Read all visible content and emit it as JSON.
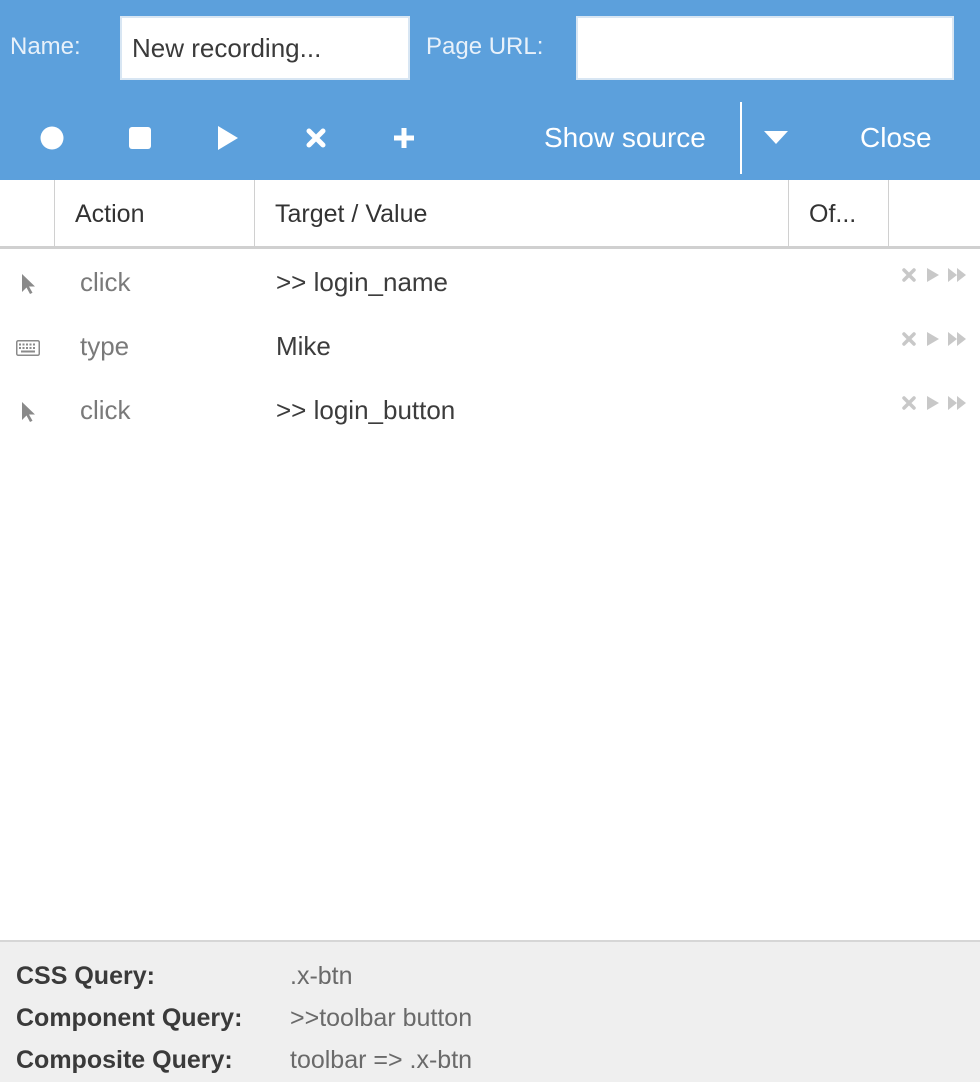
{
  "header": {
    "name_label": "Name:",
    "name_value": "New recording...",
    "url_label": "Page URL:",
    "url_value": "",
    "show_source_label": "Show source",
    "close_label": "Close",
    "icon_color": "#ffffff",
    "background": "#5ca0dc"
  },
  "toolbar": {
    "buttons": [
      {
        "name": "record",
        "icon": "record-circle-icon"
      },
      {
        "name": "stop",
        "icon": "stop-square-icon"
      },
      {
        "name": "play",
        "icon": "play-triangle-icon"
      },
      {
        "name": "clear",
        "icon": "close-x-icon"
      },
      {
        "name": "add",
        "icon": "plus-icon"
      }
    ],
    "dropdown_icon": "caret-down-icon"
  },
  "grid": {
    "columns": [
      "Action",
      "Target / Value",
      "Of..."
    ],
    "rows": [
      {
        "icon": "pointer-icon",
        "action": "click",
        "target": ">> login_name"
      },
      {
        "icon": "keyboard-icon",
        "action": "type",
        "target": "Mike"
      },
      {
        "icon": "pointer-icon",
        "action": "click",
        "target": ">> login_button"
      }
    ],
    "row_tools": [
      "delete-icon",
      "play-step-icon",
      "play-from-here-icon"
    ]
  },
  "footer": {
    "css_query_label": "CSS Query:",
    "css_query_value": ".x-btn",
    "component_query_label": "Component Query:",
    "component_query_value": ">>toolbar button",
    "composite_query_label": "Composite Query:",
    "composite_query_value": "toolbar => .x-btn"
  }
}
